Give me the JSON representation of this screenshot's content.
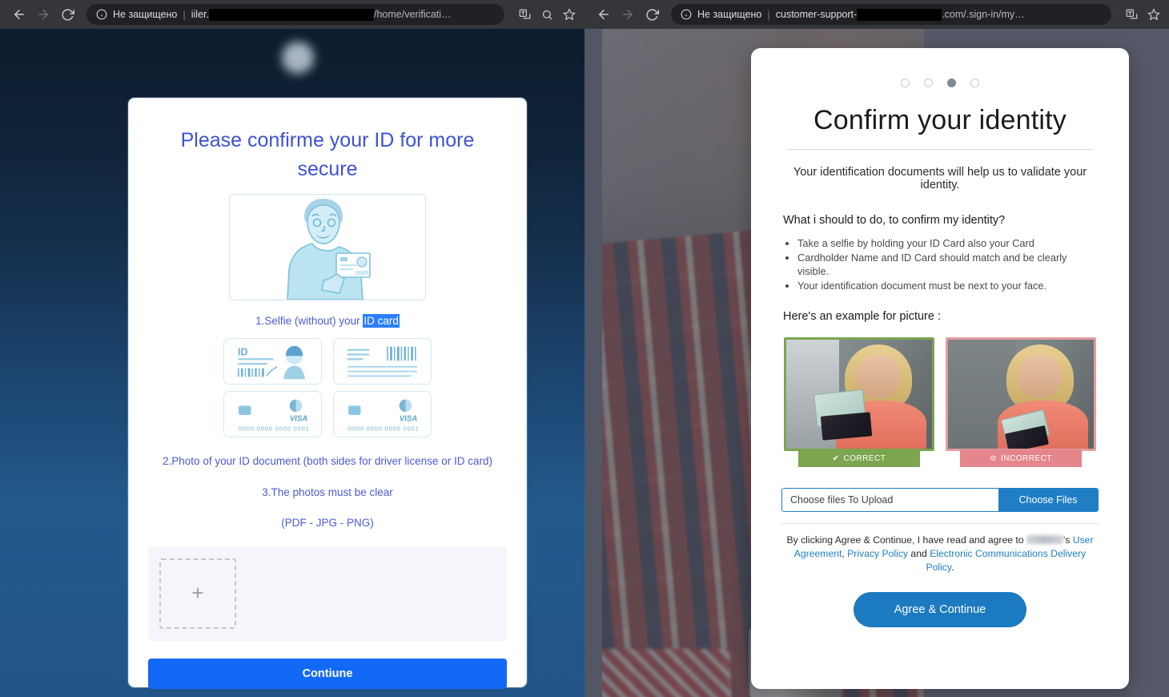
{
  "left_browser": {
    "nav": {
      "back": "back-arrow",
      "forward": "forward-arrow",
      "reload": "reload"
    },
    "omnibox": {
      "security_label": "Не защищено",
      "url_prefix": "iiler.",
      "url_suffix": "/home/verificati…"
    },
    "icons": {
      "translate": "translate-icon",
      "zoom": "zoom-out-icon",
      "bookmark": "star-icon"
    }
  },
  "right_browser": {
    "omnibox": {
      "security_label": "Не защищено",
      "url_prefix": "customer-support-",
      "url_suffix": ".com/.sign-in/my…"
    },
    "icons": {
      "translate": "translate-icon",
      "bookmark": "star-icon"
    }
  },
  "kyc_page": {
    "brand_logo_text": "",
    "title": "Please confirme your ID for more secure",
    "illustration": "selfie-with-id-illustration",
    "step1_prefix": "1.Selfie (without) your ",
    "step1_highlight": "ID card",
    "doc_cards": [
      {
        "name": "id-card-front",
        "label": "ID"
      },
      {
        "name": "id-card-back",
        "label": ""
      },
      {
        "name": "bank-card-front",
        "label": "VISA",
        "number": "0000 0000 0000 0001"
      },
      {
        "name": "bank-card-back",
        "label": "VISA",
        "number": "0000 0000 0000 0001"
      }
    ],
    "step2": "2.Photo of your ID document (both sides for driver license or ID card)",
    "step3": "3.The photos must be clear",
    "formats": "(PDF - JPG - PNG)",
    "upload_plus": "+",
    "continue_label": "Contiune",
    "accent_color": "#1269f5",
    "text_color": "#4b5bd4"
  },
  "identity_modal": {
    "steps_total": 4,
    "step_active": 3,
    "title": "Confirm your identity",
    "lead": "Your identification documents will help us to validate your identity.",
    "question": "What i should to do, to confirm my identity?",
    "bullets": [
      "Take a selfie by holding your ID Card also your Card",
      "Cardholder Name and ID Card should match and be clearly visible.",
      "Your identification document must be next to your face."
    ],
    "example_heading": "Here's an example for picture :",
    "examples": [
      {
        "name": "correct-example",
        "badge": "CORRECT",
        "icon": "check-circle-icon",
        "color": "#7ba64f"
      },
      {
        "name": "incorrect-example",
        "badge": "INCORRECT",
        "icon": "ban-circle-icon",
        "color": "#e5868c"
      }
    ],
    "file_input_placeholder": "Choose files To Upload",
    "choose_files_label": "Choose Files",
    "agree_text_1": "By clicking Agree & Continue, I have read and agree to ",
    "agree_brand": "",
    "agree_text_2": "'s ",
    "link_user_agreement": "User Agreement",
    "agree_comma": ", ",
    "link_privacy": "Privacy Policy",
    "agree_and": " and ",
    "link_electronic": "Electronic Communications Delivery Policy",
    "agree_period": ".",
    "agree_button": "Agree & Continue",
    "accent_color": "#1b7ac0"
  }
}
